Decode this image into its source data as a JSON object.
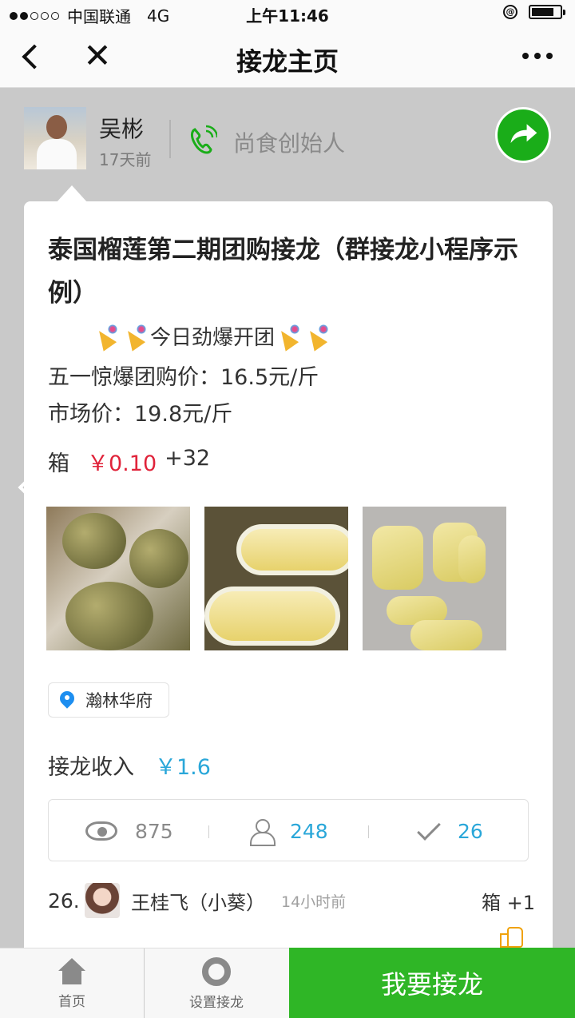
{
  "status_bar": {
    "carrier": "中国联通",
    "network": "4G",
    "time": "上午11:46"
  },
  "nav": {
    "title": "接龙主页"
  },
  "author": {
    "name": "吴彬",
    "time_ago": "17天前",
    "role": "尚食创始人"
  },
  "post": {
    "title": "泰国榴莲第二期团购接龙（群接龙小程序示例）",
    "promo_text": "今日劲爆开团",
    "group_price": "五一惊爆团购价：16.5元/斤",
    "market_price": "市场价：19.8元/斤",
    "unit": "箱",
    "price": "￥0.10",
    "count": "+32",
    "location": "瀚林华府",
    "income_label": "接龙收入",
    "income_value": "￥1.6"
  },
  "stats": {
    "views": "875",
    "participants": "248",
    "orders": "26"
  },
  "latest_order": {
    "index": "26.",
    "name": "王桂飞（小葵）",
    "time": "14小时前",
    "qty": "箱 +1"
  },
  "bottom_bar": {
    "home_label": "首页",
    "settings_label": "设置接龙",
    "join_label": "我要接龙"
  },
  "colors": {
    "accent_green": "#2fb626",
    "price_red": "#e0233a",
    "info_blue": "#2aa7d9"
  },
  "icons": [
    "back-icon",
    "close-icon",
    "more-icon",
    "phone-icon",
    "share-icon",
    "location-pin-icon",
    "eye-icon",
    "person-icon",
    "check-icon",
    "thumbs-up-icon",
    "home-icon",
    "gear-icon"
  ]
}
